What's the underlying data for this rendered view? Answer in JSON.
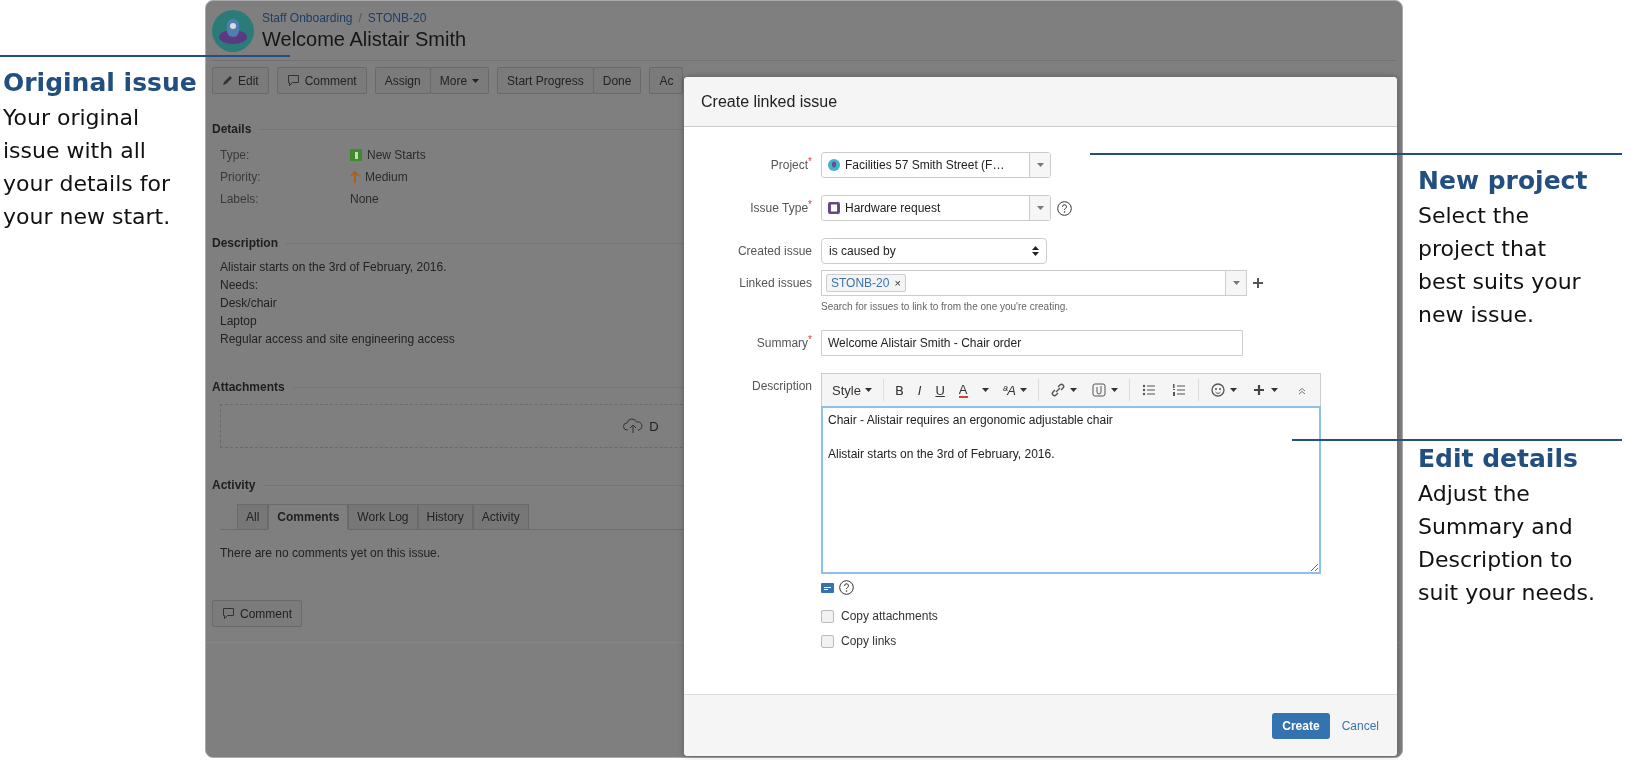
{
  "callouts_left": [
    {
      "title": "Original issue",
      "body": "Your original issue with all your details for your new start."
    }
  ],
  "callouts_right": [
    {
      "title": "New project",
      "body": "Select the project that best suits your new issue."
    },
    {
      "title": "Edit details",
      "body": "Adjust the Summary and Description to suit your needs."
    }
  ],
  "issue": {
    "breadcrumb": [
      "Staff Onboarding",
      "STONB-20"
    ],
    "separator": "/",
    "title": "Welcome Alistair Smith",
    "action_groups": [
      {
        "buttons": [
          {
            "label": "Edit",
            "dropdown": false
          }
        ]
      },
      {
        "buttons": [
          {
            "label": "Comment",
            "dropdown": false
          }
        ]
      },
      {
        "buttons": [
          {
            "label": "Assign",
            "dropdown": false
          },
          {
            "label": "More",
            "dropdown": true
          }
        ]
      },
      {
        "buttons": [
          {
            "label": "Start Progress",
            "dropdown": false
          },
          {
            "label": "Done",
            "dropdown": false
          }
        ]
      },
      {
        "buttons": [
          {
            "label": "Ac",
            "dropdown": false
          }
        ]
      }
    ],
    "details_heading": "Details",
    "details": [
      {
        "label": "Type:",
        "value": "New Starts"
      },
      {
        "label": "Priority:",
        "value": "Medium"
      },
      {
        "label": "Labels:",
        "value": "None"
      }
    ],
    "description_heading": "Description",
    "description_lines": [
      "Alistair starts on the 3rd of February, 2016.",
      "Needs:",
      "Desk/chair",
      "Laptop",
      "Regular access and site engineering access"
    ],
    "attachments_heading": "Attachments",
    "drop_text": "D",
    "activity_heading": "Activity",
    "tabs": [
      {
        "label": "All",
        "selected": false
      },
      {
        "label": "Comments",
        "selected": true
      },
      {
        "label": "Work Log",
        "selected": false
      },
      {
        "label": "History",
        "selected": false
      },
      {
        "label": "Activity",
        "selected": false
      }
    ],
    "empty_comments": "There are no comments yet on this issue.",
    "comment_button": "Comment"
  },
  "dialog": {
    "title": "Create linked issue",
    "required_mark": "*",
    "project": {
      "label": "Project",
      "required": true,
      "value": "Facilities 57 Smith Street (F…"
    },
    "issue_type": {
      "label": "Issue Type",
      "required": true,
      "value": "Hardware request"
    },
    "created_issue": {
      "label": "Created issue",
      "required": false,
      "value": "is caused by"
    },
    "linked_issues": {
      "label": "Linked issues",
      "required": false,
      "tags": [
        {
          "label": "STONB-20",
          "remove": "×"
        }
      ],
      "hint": "Search for issues to link to from the one you're creating."
    },
    "summary": {
      "label": "Summary",
      "required": true,
      "value": "Welcome Alistair Smith - Chair order"
    },
    "description": {
      "label": "Description",
      "required": false,
      "toolbar": [
        {
          "kind": "menu",
          "label": "Style"
        },
        {
          "kind": "separator"
        },
        {
          "kind": "bold",
          "label": "B"
        },
        {
          "kind": "italic",
          "label": "I"
        },
        {
          "kind": "underline",
          "label": "U"
        },
        {
          "kind": "color",
          "label": "A"
        },
        {
          "kind": "caret"
        },
        {
          "kind": "textsize",
          "label": "ªA"
        },
        {
          "kind": "separator"
        },
        {
          "kind": "link"
        },
        {
          "kind": "attachment"
        },
        {
          "kind": "separator"
        },
        {
          "kind": "bullets"
        },
        {
          "kind": "numbers"
        },
        {
          "kind": "separator"
        },
        {
          "kind": "emoji"
        },
        {
          "kind": "insert"
        },
        {
          "kind": "spacer"
        },
        {
          "kind": "collapse"
        }
      ],
      "lines": [
        "Chair - Alistair requires an ergonomic adjustable chair",
        "Alistair starts on the 3rd of February, 2016."
      ]
    },
    "options": [
      {
        "label": "Copy attachments",
        "checked": false
      },
      {
        "label": "Copy links",
        "checked": false
      }
    ],
    "create": "Create",
    "cancel": "Cancel"
  }
}
